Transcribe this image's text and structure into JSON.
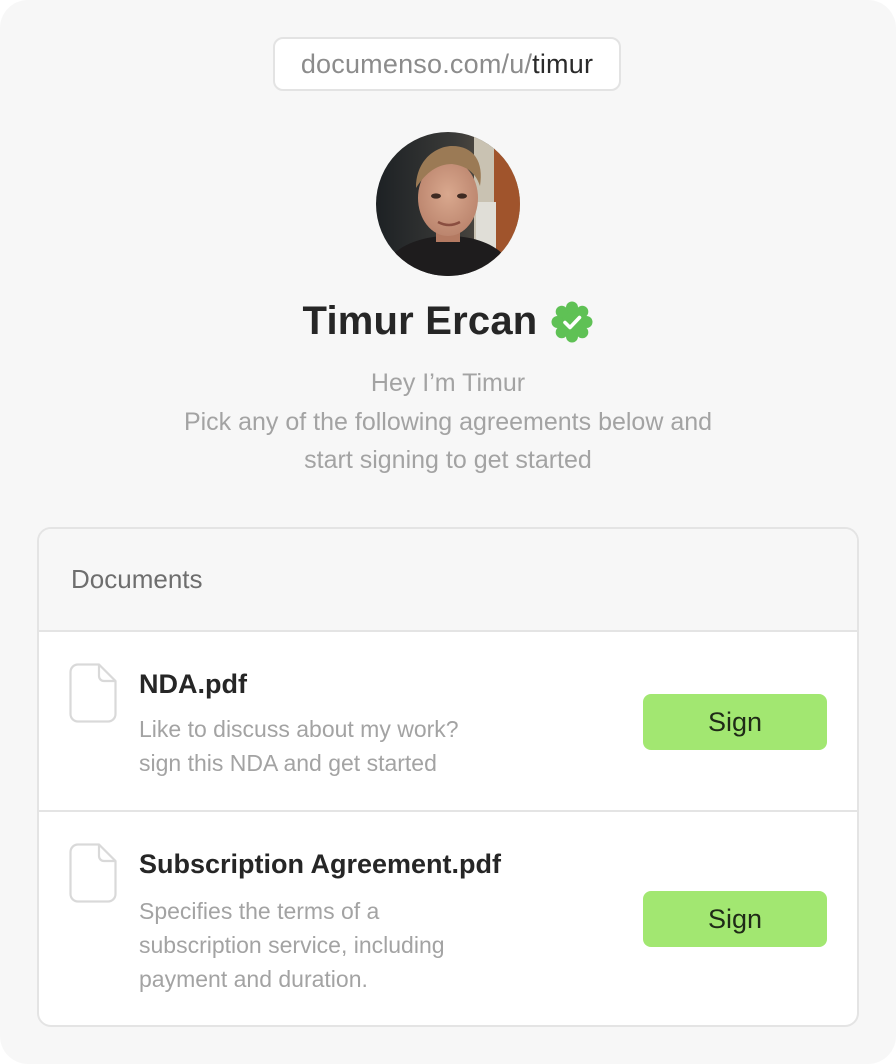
{
  "profile_url": {
    "prefix": "documenso.com/u/",
    "username": "timur"
  },
  "profile": {
    "name": "Timur Ercan",
    "verified_badge_icon": "verified-check-badge-icon",
    "bio_lines": [
      "Hey I’m Timur",
      "Pick any of the following agreements below and",
      "start signing to get started"
    ]
  },
  "documents_card": {
    "heading": "Documents",
    "items": [
      {
        "icon": "file-icon",
        "title": "NDA.pdf",
        "description_lines": [
          "Like to discuss about my work?",
          "sign this NDA and get started"
        ],
        "button_label": "Sign"
      },
      {
        "icon": "file-icon",
        "title": "Subscription Agreement.pdf",
        "description_lines": [
          "Specifies the terms of a",
          "subscription service, including",
          "payment and duration."
        ],
        "button_label": "Sign"
      }
    ]
  },
  "colors": {
    "accent_green": "#a2e771",
    "verified_green": "#5fc155",
    "text_dark": "#262626",
    "text_muted": "#a3a3a3",
    "background": "#f7f7f7"
  }
}
